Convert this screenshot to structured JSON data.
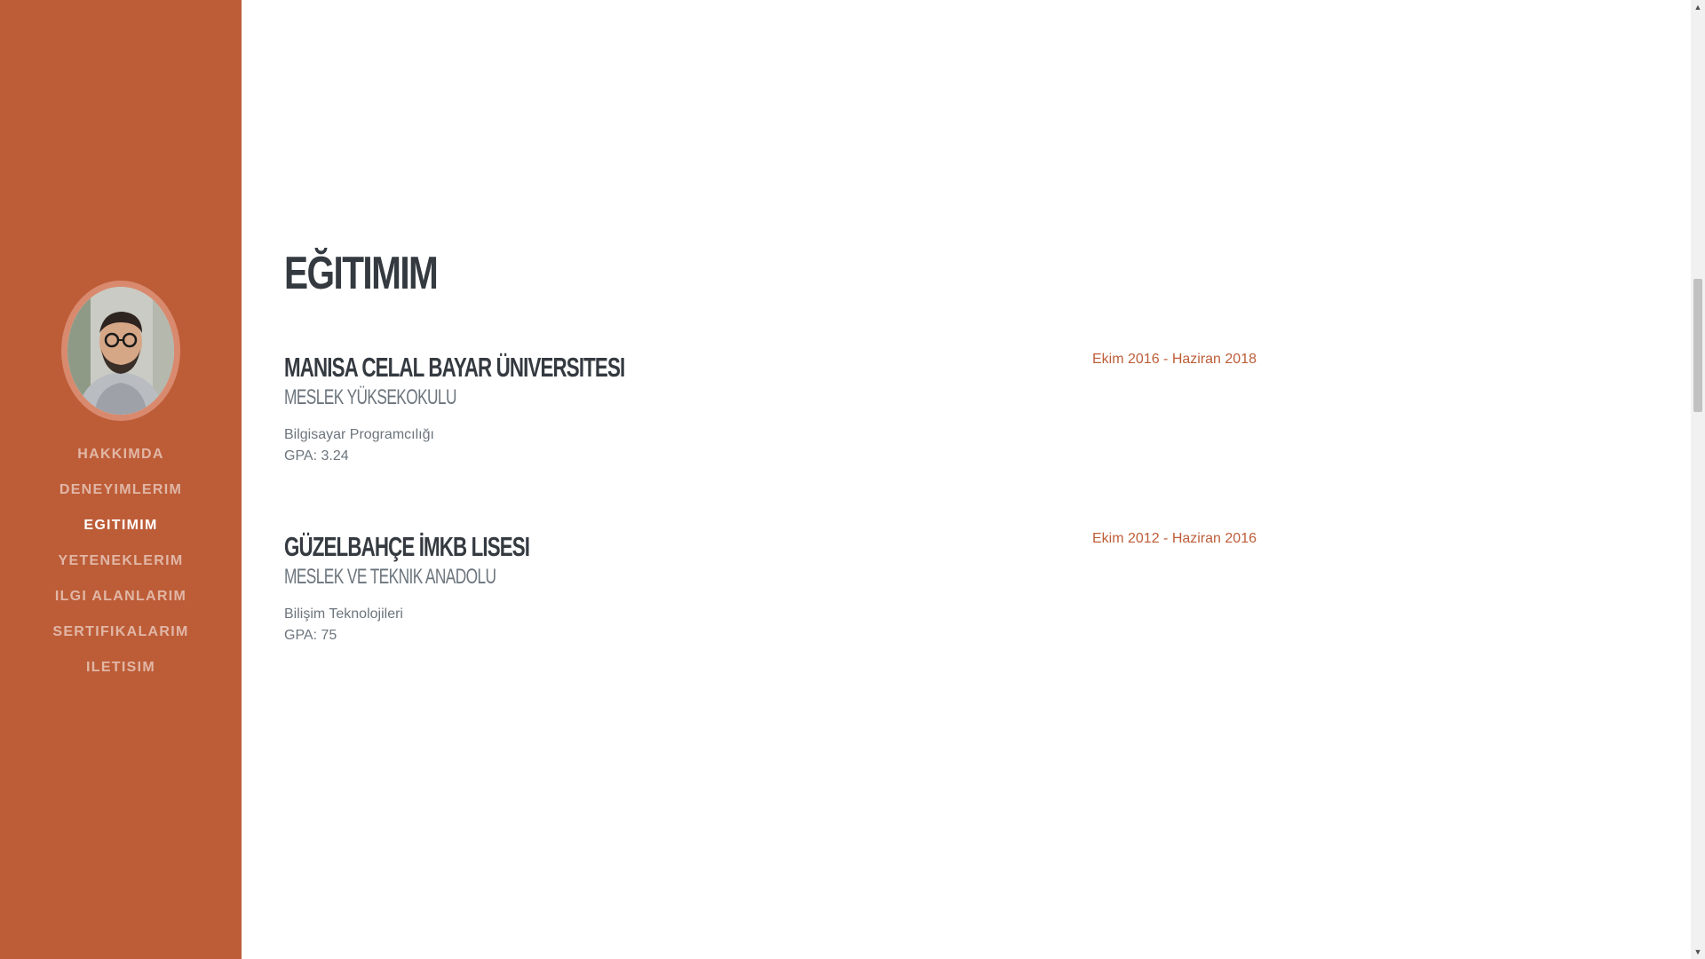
{
  "nav": {
    "items": [
      {
        "label": "HAKKIMDA"
      },
      {
        "label": "DENEYIMLERIM"
      },
      {
        "label": "EGITIMIM"
      },
      {
        "label": "YETENEKLERIM"
      },
      {
        "label": "ILGI ALANLARIM"
      },
      {
        "label": "SERTIFIKALARIM"
      },
      {
        "label": "ILETISIM"
      }
    ],
    "active": "EGITIMIM"
  },
  "section": {
    "title": "EĞITIMIM"
  },
  "education": [
    {
      "school": "MANISA CELAL BAYAR ÜNIVERSITESI",
      "unit": "MESLEK YÜKSEKOKULU",
      "program": "Bilgisayar Programcılığı",
      "gpa": "GPA: 3.24",
      "dates": "Ekim 2016 - Haziran 2018"
    },
    {
      "school": "GÜZELBAHÇE İMKB LISESI",
      "unit": "MESLEK VE TEKNIK ANADOLU",
      "program": "Bilişim Teknolojileri",
      "gpa": "GPA: 75",
      "dates": "Ekim 2012 - Haziran 2016"
    }
  ],
  "colors": {
    "sidebar": "#bd5d38",
    "heading": "#343a40",
    "muted": "#6c757d",
    "accent": "#bd5d38"
  }
}
